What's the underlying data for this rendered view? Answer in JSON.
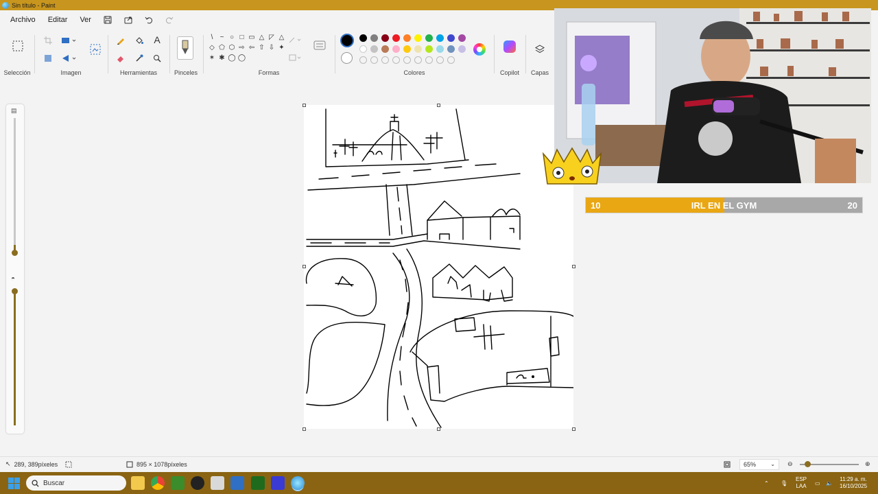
{
  "window": {
    "title": "Sin título - Paint"
  },
  "menu": {
    "archivo": "Archivo",
    "editar": "Editar",
    "ver": "Ver"
  },
  "ribbon": {
    "groups": {
      "seleccion": "Selección",
      "imagen": "Imagen",
      "herramientas": "Herramientas",
      "pinceles": "Pinceles",
      "formas": "Formas",
      "colores": "Colores",
      "copilot": "Copilot",
      "capas": "Capas"
    },
    "text_tool_glyph": "A",
    "shape_glyphs": [
      "\\",
      "~",
      "○",
      "□",
      "▭",
      "△",
      "◸",
      "△",
      "◇",
      "⬠",
      "⬡",
      "⇨",
      "⇦",
      "⇧",
      "⇩",
      "✦",
      "✶",
      "✱",
      "◯",
      "◯"
    ],
    "palette_row1": [
      "#000000",
      "#7f7f7f",
      "#880015",
      "#ed1c24",
      "#ff7f27",
      "#fff200",
      "#22b14c",
      "#00a2e8",
      "#3f48cc",
      "#a349a4"
    ],
    "palette_row2": [
      "#ffffff",
      "#c3c3c3",
      "#b97a57",
      "#ffaec9",
      "#ffc90e",
      "#efe4b0",
      "#b5e61d",
      "#99d9ea",
      "#7092be",
      "#c8bfe7"
    ],
    "selected_color": "#000000"
  },
  "status": {
    "cursor_position": "289, 389píxeles",
    "canvas_size": "895 × 1078píxeles",
    "zoom": "65%"
  },
  "taskbar": {
    "search_placeholder": "Buscar",
    "language": "ESP",
    "layout": "LAA",
    "time": "11:29 a. m.",
    "date": "16/10/2025"
  },
  "overlay": {
    "goal_label": "IRL EN EL GYM",
    "goal_current": "10",
    "goal_target": "20",
    "progress_fraction": 0.5
  }
}
